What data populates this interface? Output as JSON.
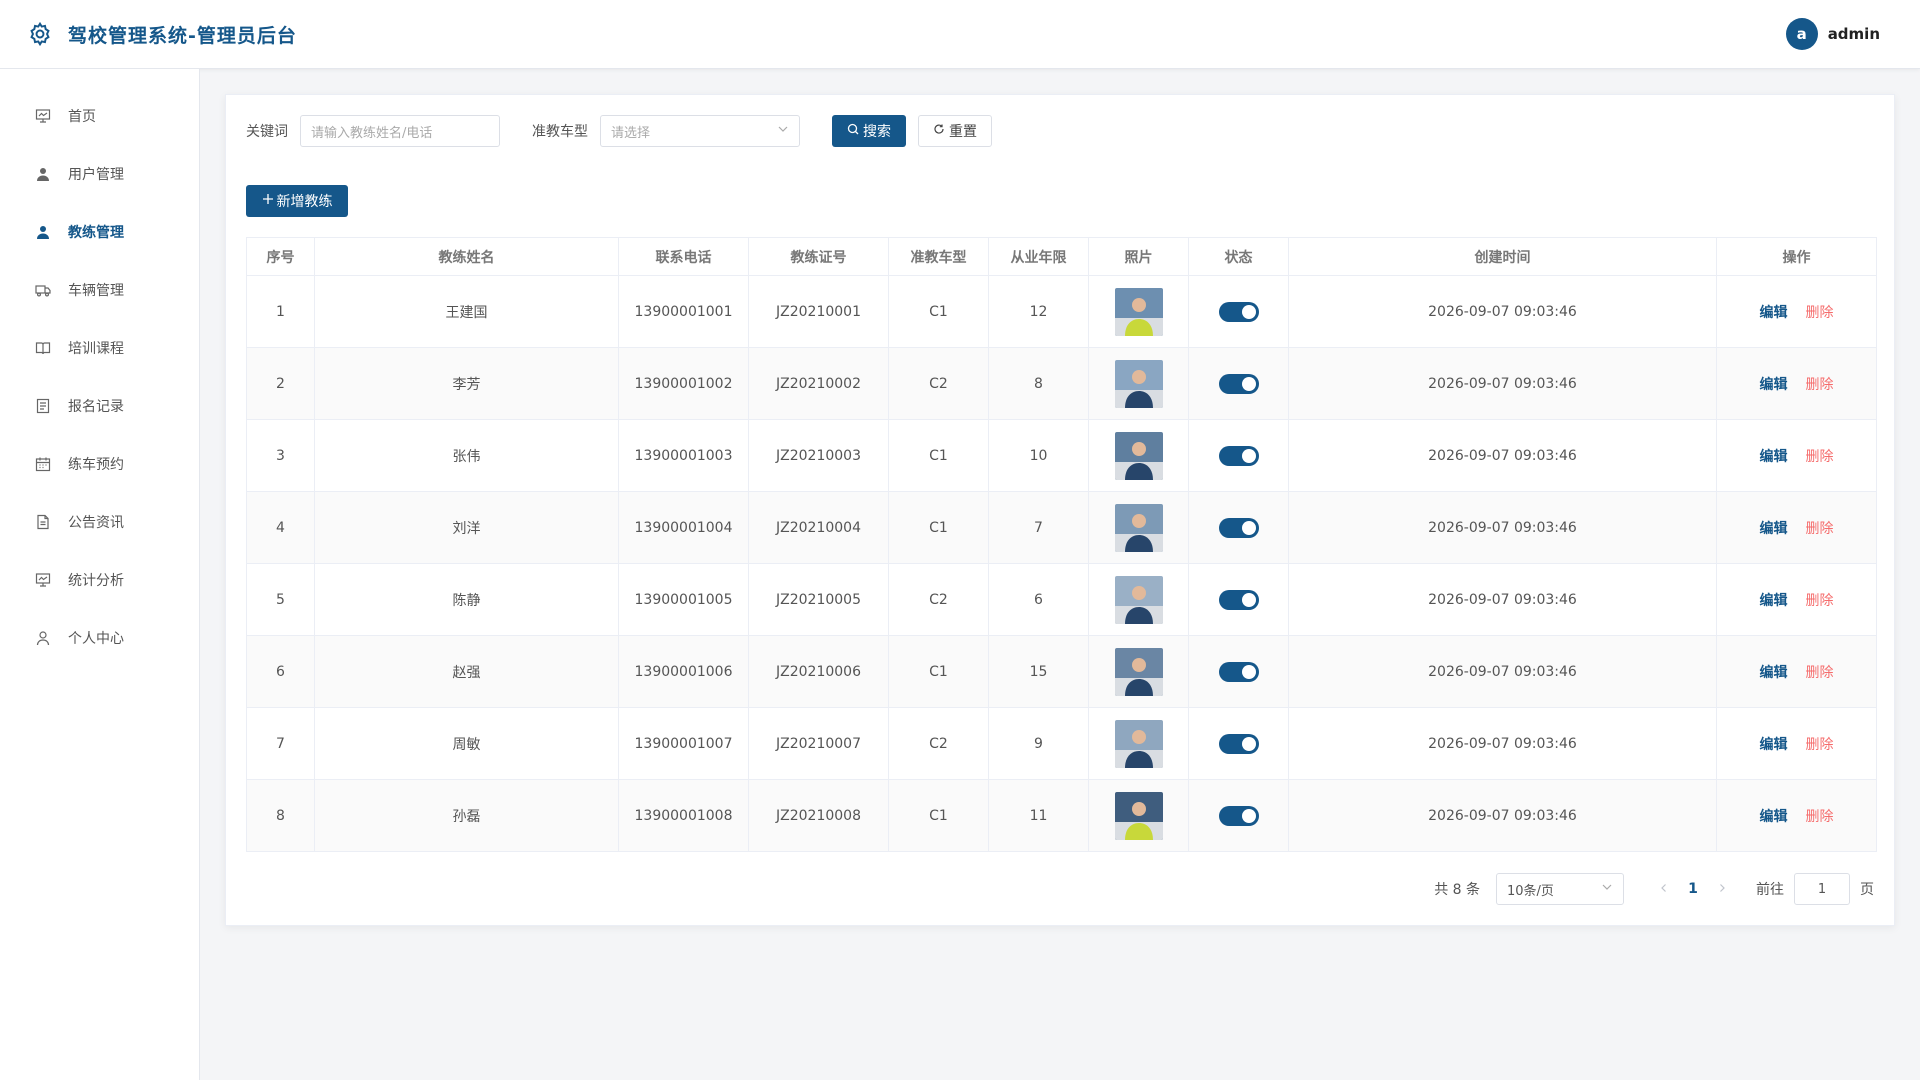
{
  "header": {
    "title": "驾校管理系统-管理员后台",
    "user": {
      "avatar_letter": "a",
      "name": "admin"
    }
  },
  "sidebar": {
    "items": [
      {
        "label": "首页",
        "icon": "monitor-icon",
        "active": false
      },
      {
        "label": "用户管理",
        "icon": "user-icon",
        "active": false
      },
      {
        "label": "教练管理",
        "icon": "user-icon",
        "active": true
      },
      {
        "label": "车辆管理",
        "icon": "truck-icon",
        "active": false
      },
      {
        "label": "培训课程",
        "icon": "book-icon",
        "active": false
      },
      {
        "label": "报名记录",
        "icon": "document-icon",
        "active": false
      },
      {
        "label": "练车预约",
        "icon": "calendar-icon",
        "active": false
      },
      {
        "label": "公告资讯",
        "icon": "file-icon",
        "active": false
      },
      {
        "label": "统计分析",
        "icon": "monitor-icon",
        "active": false
      },
      {
        "label": "个人中心",
        "icon": "person-outline-icon",
        "active": false
      }
    ]
  },
  "filters": {
    "keyword_label": "关键词",
    "keyword_placeholder": "请输入教练姓名/电话",
    "car_type_label": "准教车型",
    "car_type_placeholder": "请选择",
    "search_label": "搜索",
    "reset_label": "重置"
  },
  "add_button_label": "新增教练",
  "table": {
    "columns": [
      "序号",
      "教练姓名",
      "联系电话",
      "教练证号",
      "准教车型",
      "从业年限",
      "照片",
      "状态",
      "创建时间",
      "操作"
    ],
    "edit_label": "编辑",
    "delete_label": "删除",
    "rows": [
      {
        "index": "1",
        "name": "王建国",
        "phone": "13900001001",
        "cert": "JZ20210001",
        "car_type": "C1",
        "years": "12",
        "status": true,
        "created": "2026-09-07 09:03:46"
      },
      {
        "index": "2",
        "name": "李芳",
        "phone": "13900001002",
        "cert": "JZ20210002",
        "car_type": "C2",
        "years": "8",
        "status": true,
        "created": "2026-09-07 09:03:46"
      },
      {
        "index": "3",
        "name": "张伟",
        "phone": "13900001003",
        "cert": "JZ20210003",
        "car_type": "C1",
        "years": "10",
        "status": true,
        "created": "2026-09-07 09:03:46"
      },
      {
        "index": "4",
        "name": "刘洋",
        "phone": "13900001004",
        "cert": "JZ20210004",
        "car_type": "C1",
        "years": "7",
        "status": true,
        "created": "2026-09-07 09:03:46"
      },
      {
        "index": "5",
        "name": "陈静",
        "phone": "13900001005",
        "cert": "JZ20210005",
        "car_type": "C2",
        "years": "6",
        "status": true,
        "created": "2026-09-07 09:03:46"
      },
      {
        "index": "6",
        "name": "赵强",
        "phone": "13900001006",
        "cert": "JZ20210006",
        "car_type": "C1",
        "years": "15",
        "status": true,
        "created": "2026-09-07 09:03:46"
      },
      {
        "index": "7",
        "name": "周敏",
        "phone": "13900001007",
        "cert": "JZ20210007",
        "car_type": "C2",
        "years": "9",
        "status": true,
        "created": "2026-09-07 09:03:46"
      },
      {
        "index": "8",
        "name": "孙磊",
        "phone": "13900001008",
        "cert": "JZ20210008",
        "car_type": "C1",
        "years": "11",
        "status": true,
        "created": "2026-09-07 09:03:46"
      }
    ]
  },
  "pagination": {
    "total_text": "共 8 条",
    "page_size": "10条/页",
    "current_page": "1",
    "goto_label": "前往",
    "goto_value": "1",
    "page_suffix": "页"
  },
  "colors": {
    "primary": "#15578a",
    "danger": "#f56c6c"
  }
}
